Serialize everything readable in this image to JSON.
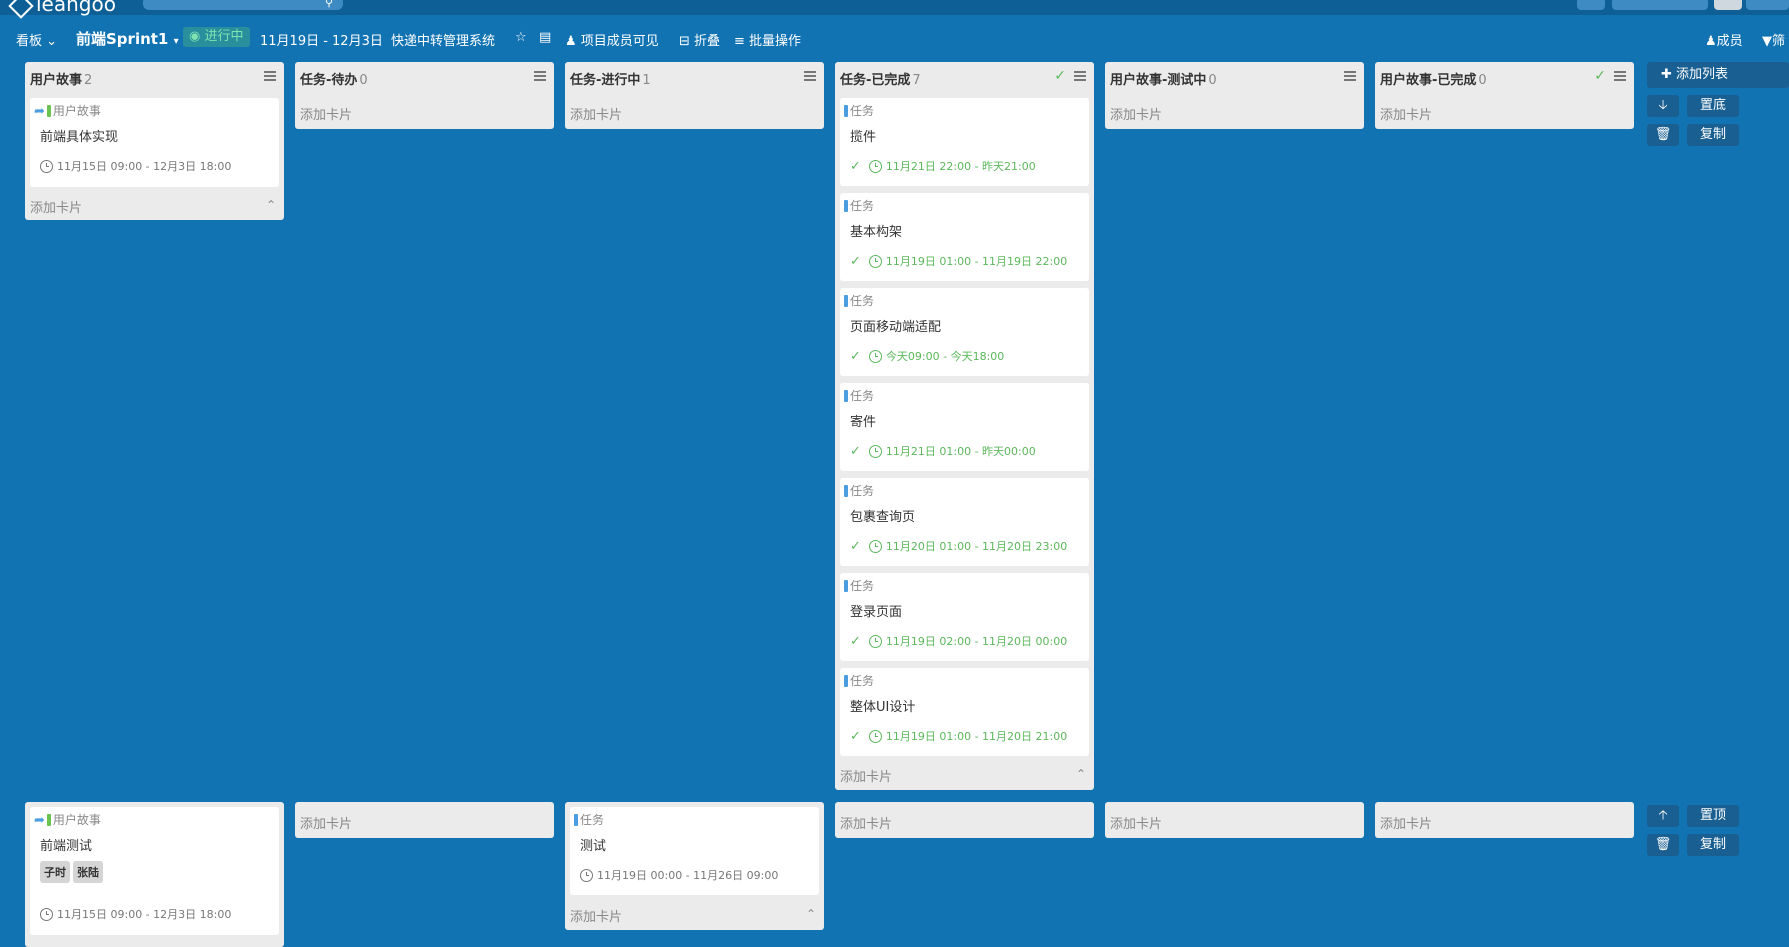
{
  "app": {
    "logo_text": "leangoo"
  },
  "toolbar": {
    "view": "看板",
    "board_name": "前端Sprint1",
    "status": "进行中",
    "date_range": "11月19日 - 12月3日",
    "project": "快递中转管理系统",
    "visibility": "项目成员可见",
    "collapse": "折叠",
    "batch": "批量操作",
    "members": "成员",
    "filter": "筛"
  },
  "lists": [
    {
      "title": "用户故事",
      "count": "2"
    },
    {
      "title": "任务-待办",
      "count": "0"
    },
    {
      "title": "任务-进行中",
      "count": "1"
    },
    {
      "title": "任务-已完成",
      "count": "7"
    },
    {
      "title": "用户故事-测试中",
      "count": "0"
    },
    {
      "title": "用户故事-已完成",
      "count": "0"
    }
  ],
  "add_card": "添加卡片",
  "row1": {
    "story_card": {
      "type": "用户故事",
      "title": "前端具体实现",
      "time": "11月15日 09:00 - 12月3日 18:00"
    },
    "done_cards": [
      {
        "type": "任务",
        "title": "揽件",
        "time": "11月21日 22:00 - 昨天21:00"
      },
      {
        "type": "任务",
        "title": "基本构架",
        "time": "11月19日 01:00 - 11月19日 22:00"
      },
      {
        "type": "任务",
        "title": "页面移动端适配",
        "time": "今天09:00 - 今天18:00"
      },
      {
        "type": "任务",
        "title": "寄件",
        "time": "11月21日 01:00 - 昨天00:00"
      },
      {
        "type": "任务",
        "title": "包裹查询页",
        "time": "11月20日 01:00 - 11月20日 23:00"
      },
      {
        "type": "任务",
        "title": "登录页面",
        "time": "11月19日 02:00 - 11月20日 00:00"
      },
      {
        "type": "任务",
        "title": "整体UI设计",
        "time": "11月19日 01:00 - 11月20日 21:00"
      }
    ]
  },
  "row2": {
    "story_card": {
      "type": "用户故事",
      "title": "前端测试",
      "tags": [
        "子时",
        "张陆"
      ],
      "time": "11月15日 09:00 - 12月3日 18:00"
    },
    "progress_card": {
      "type": "任务",
      "title": "测试",
      "time": "11月19日 00:00 - 11月26日 09:00"
    }
  },
  "side": {
    "add_list": "添加列表",
    "bottom": "置底",
    "top": "置顶",
    "copy": "复制"
  }
}
